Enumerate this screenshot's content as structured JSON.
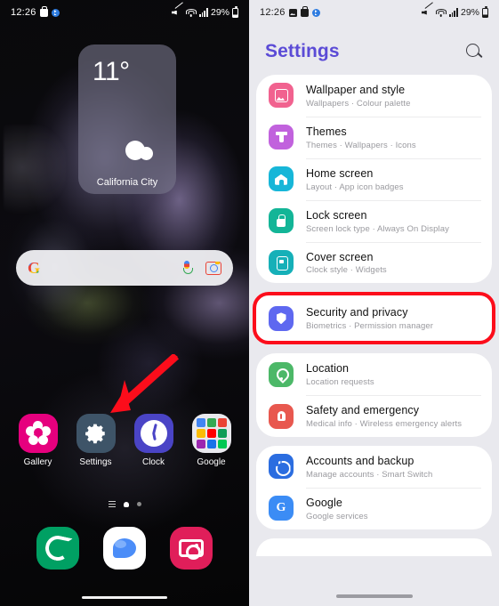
{
  "left_phone": {
    "statusbar": {
      "time": "12:26",
      "left_icons": [
        "briefcase-icon",
        "bluetooth-badge-icon"
      ],
      "right_icons": [
        "mute-icon",
        "wifi-icon",
        "signal-bars-icon"
      ],
      "battery_text": "29%"
    },
    "weather_widget": {
      "temperature": "11°",
      "city": "California City",
      "condition_icon": "cloud-icon"
    },
    "google_search": {
      "placeholder": "",
      "logo": "google-g-icon",
      "mic_icon": "microphone-icon",
      "lens_icon": "google-lens-icon"
    },
    "app_row": [
      {
        "label": "Gallery",
        "icon": "gallery-flower-icon",
        "color": "#e6007e"
      },
      {
        "label": "Settings",
        "icon": "gear-icon",
        "color": "#3e5468"
      },
      {
        "label": "Clock",
        "icon": "clock-icon",
        "color": "#4a44c6"
      },
      {
        "label": "Google",
        "icon": "google-folder-icon",
        "color": "#e9e9ee"
      }
    ],
    "dock": [
      {
        "label": "Phone",
        "icon": "phone-icon",
        "color": "#00a063"
      },
      {
        "label": "Messages",
        "icon": "message-bubble-icon",
        "color": "#ffffff"
      },
      {
        "label": "Camera",
        "icon": "camera-icon",
        "color": "#e01e5a"
      }
    ],
    "page_indicator": {
      "pages": 3,
      "active_index": 1
    },
    "annotation": {
      "arrow_color": "#fc0d1b",
      "points_to": "Settings"
    }
  },
  "right_phone": {
    "statusbar": {
      "time": "12:26",
      "left_icons": [
        "screenshot-icon",
        "briefcase-icon",
        "bluetooth-badge-icon"
      ],
      "right_icons": [
        "mute-icon",
        "wifi-icon",
        "signal-bars-icon"
      ],
      "battery_text": "29%"
    },
    "header": {
      "title": "Settings",
      "search_icon": "search-icon"
    },
    "accent_color": "#5b4bd6",
    "highlight_color": "#fc0d1b",
    "cards": [
      {
        "items": [
          {
            "title": "Wallpaper and style",
            "subtitle": "Wallpapers  ·  Colour palette",
            "icon": "image-icon",
            "icon_color": "#f1628f",
            "glyph": "gi-image",
            "highlighted": false
          },
          {
            "title": "Themes",
            "subtitle": "Themes  ·  Wallpapers  ·  Icons",
            "icon": "paint-brush-icon",
            "icon_color": "#c162dd",
            "glyph": "gi-brush",
            "highlighted": false
          },
          {
            "title": "Home screen",
            "subtitle": "Layout  ·  App icon badges",
            "icon": "home-icon",
            "icon_color": "#17b6d8",
            "glyph": "gi-home",
            "highlighted": false
          },
          {
            "title": "Lock screen",
            "subtitle": "Screen lock type  ·  Always On Display",
            "icon": "lock-icon",
            "icon_color": "#13b597",
            "glyph": "gi-lock",
            "highlighted": false
          },
          {
            "title": "Cover screen",
            "subtitle": "Clock style  ·  Widgets",
            "icon": "cover-screen-icon",
            "icon_color": "#16b0b8",
            "glyph": "gi-cover",
            "highlighted": false
          }
        ]
      },
      {
        "highlighted": true,
        "items": [
          {
            "title": "Security and privacy",
            "subtitle": "Biometrics  ·  Permission manager",
            "icon": "shield-icon",
            "icon_color": "#5e68f0",
            "glyph": "gi-shield",
            "highlighted": true
          }
        ]
      },
      {
        "items": [
          {
            "title": "Location",
            "subtitle": "Location requests",
            "icon": "location-pin-icon",
            "icon_color": "#4cb868",
            "glyph": "gi-pin",
            "highlighted": false
          },
          {
            "title": "Safety and emergency",
            "subtitle": "Medical info  ·  Wireless emergency alerts",
            "icon": "safety-emergency-icon",
            "icon_color": "#e8584f",
            "glyph": "gi-safety",
            "highlighted": false
          }
        ]
      },
      {
        "items": [
          {
            "title": "Accounts and backup",
            "subtitle": "Manage accounts  ·  Smart Switch",
            "icon": "sync-icon",
            "icon_color": "#2b6de0",
            "glyph": "gi-sync",
            "highlighted": false
          },
          {
            "title": "Google",
            "subtitle": "Google services",
            "icon": "google-icon",
            "icon_color": "#3b8cf5",
            "glyph": "gi-g",
            "highlighted": false
          }
        ]
      }
    ]
  }
}
